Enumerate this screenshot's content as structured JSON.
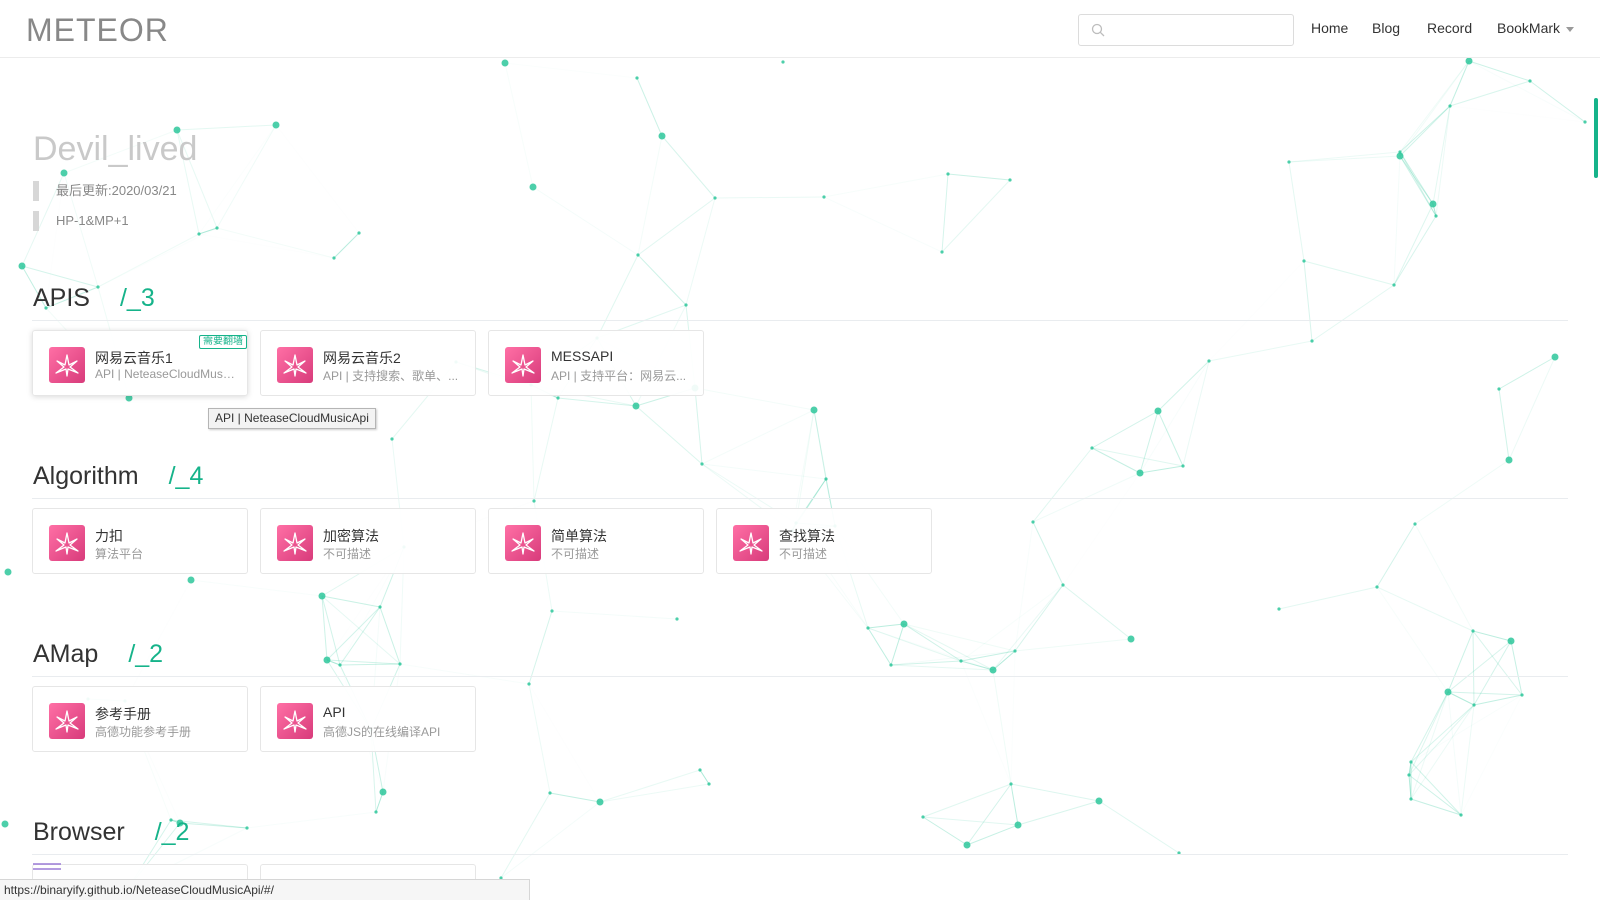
{
  "header": {
    "logo": "METEOR",
    "search": {
      "value": "",
      "placeholder": ""
    },
    "nav": [
      {
        "label": "Home"
      },
      {
        "label": "Blog"
      },
      {
        "label": "Record"
      },
      {
        "label": "BookMark"
      }
    ]
  },
  "profile": {
    "name": "Devil_lived",
    "updated": "最后更新:2020/03/21",
    "motto": "HP-1&MP+1"
  },
  "sections": [
    {
      "title": "APIS",
      "count": "/_3",
      "cards": [
        {
          "title": "网易云音乐1",
          "desc": "API | NeteaseCloudMusicApi",
          "badge": "需要翻墙"
        },
        {
          "title": "网易云音乐2",
          "desc": "API | 支持搜索、歌单、..."
        },
        {
          "title": "MESSAPI",
          "desc": "API | 支持平台：网易云..."
        }
      ]
    },
    {
      "title": "Algorithm",
      "count": "/_4",
      "cards": [
        {
          "title": "力扣",
          "desc": "算法平台"
        },
        {
          "title": "加密算法",
          "desc": "不可描述"
        },
        {
          "title": "简单算法",
          "desc": "不可描述"
        },
        {
          "title": "查找算法",
          "desc": "不可描述"
        }
      ]
    },
    {
      "title": "AMap",
      "count": "/_2",
      "cards": [
        {
          "title": "参考手册",
          "desc": "高德功能参考手册"
        },
        {
          "title": "API",
          "desc": "高德JS的在线编译API"
        }
      ]
    },
    {
      "title": "Browser",
      "count": "/_2",
      "cards": []
    }
  ],
  "tooltip": "API | NeteaseCloudMusicApi",
  "status_url": "https://binaryify.github.io/NeteaseCloudMusicApi/#/",
  "colors": {
    "accent": "#16b38a",
    "icon_gradient_start": "#ff6fa5",
    "icon_gradient_end": "#d83b7b",
    "network": "#2ec79b"
  },
  "icons": {
    "search": "search-icon",
    "card": "meteor-app-icon",
    "menu": "menu-icon"
  }
}
